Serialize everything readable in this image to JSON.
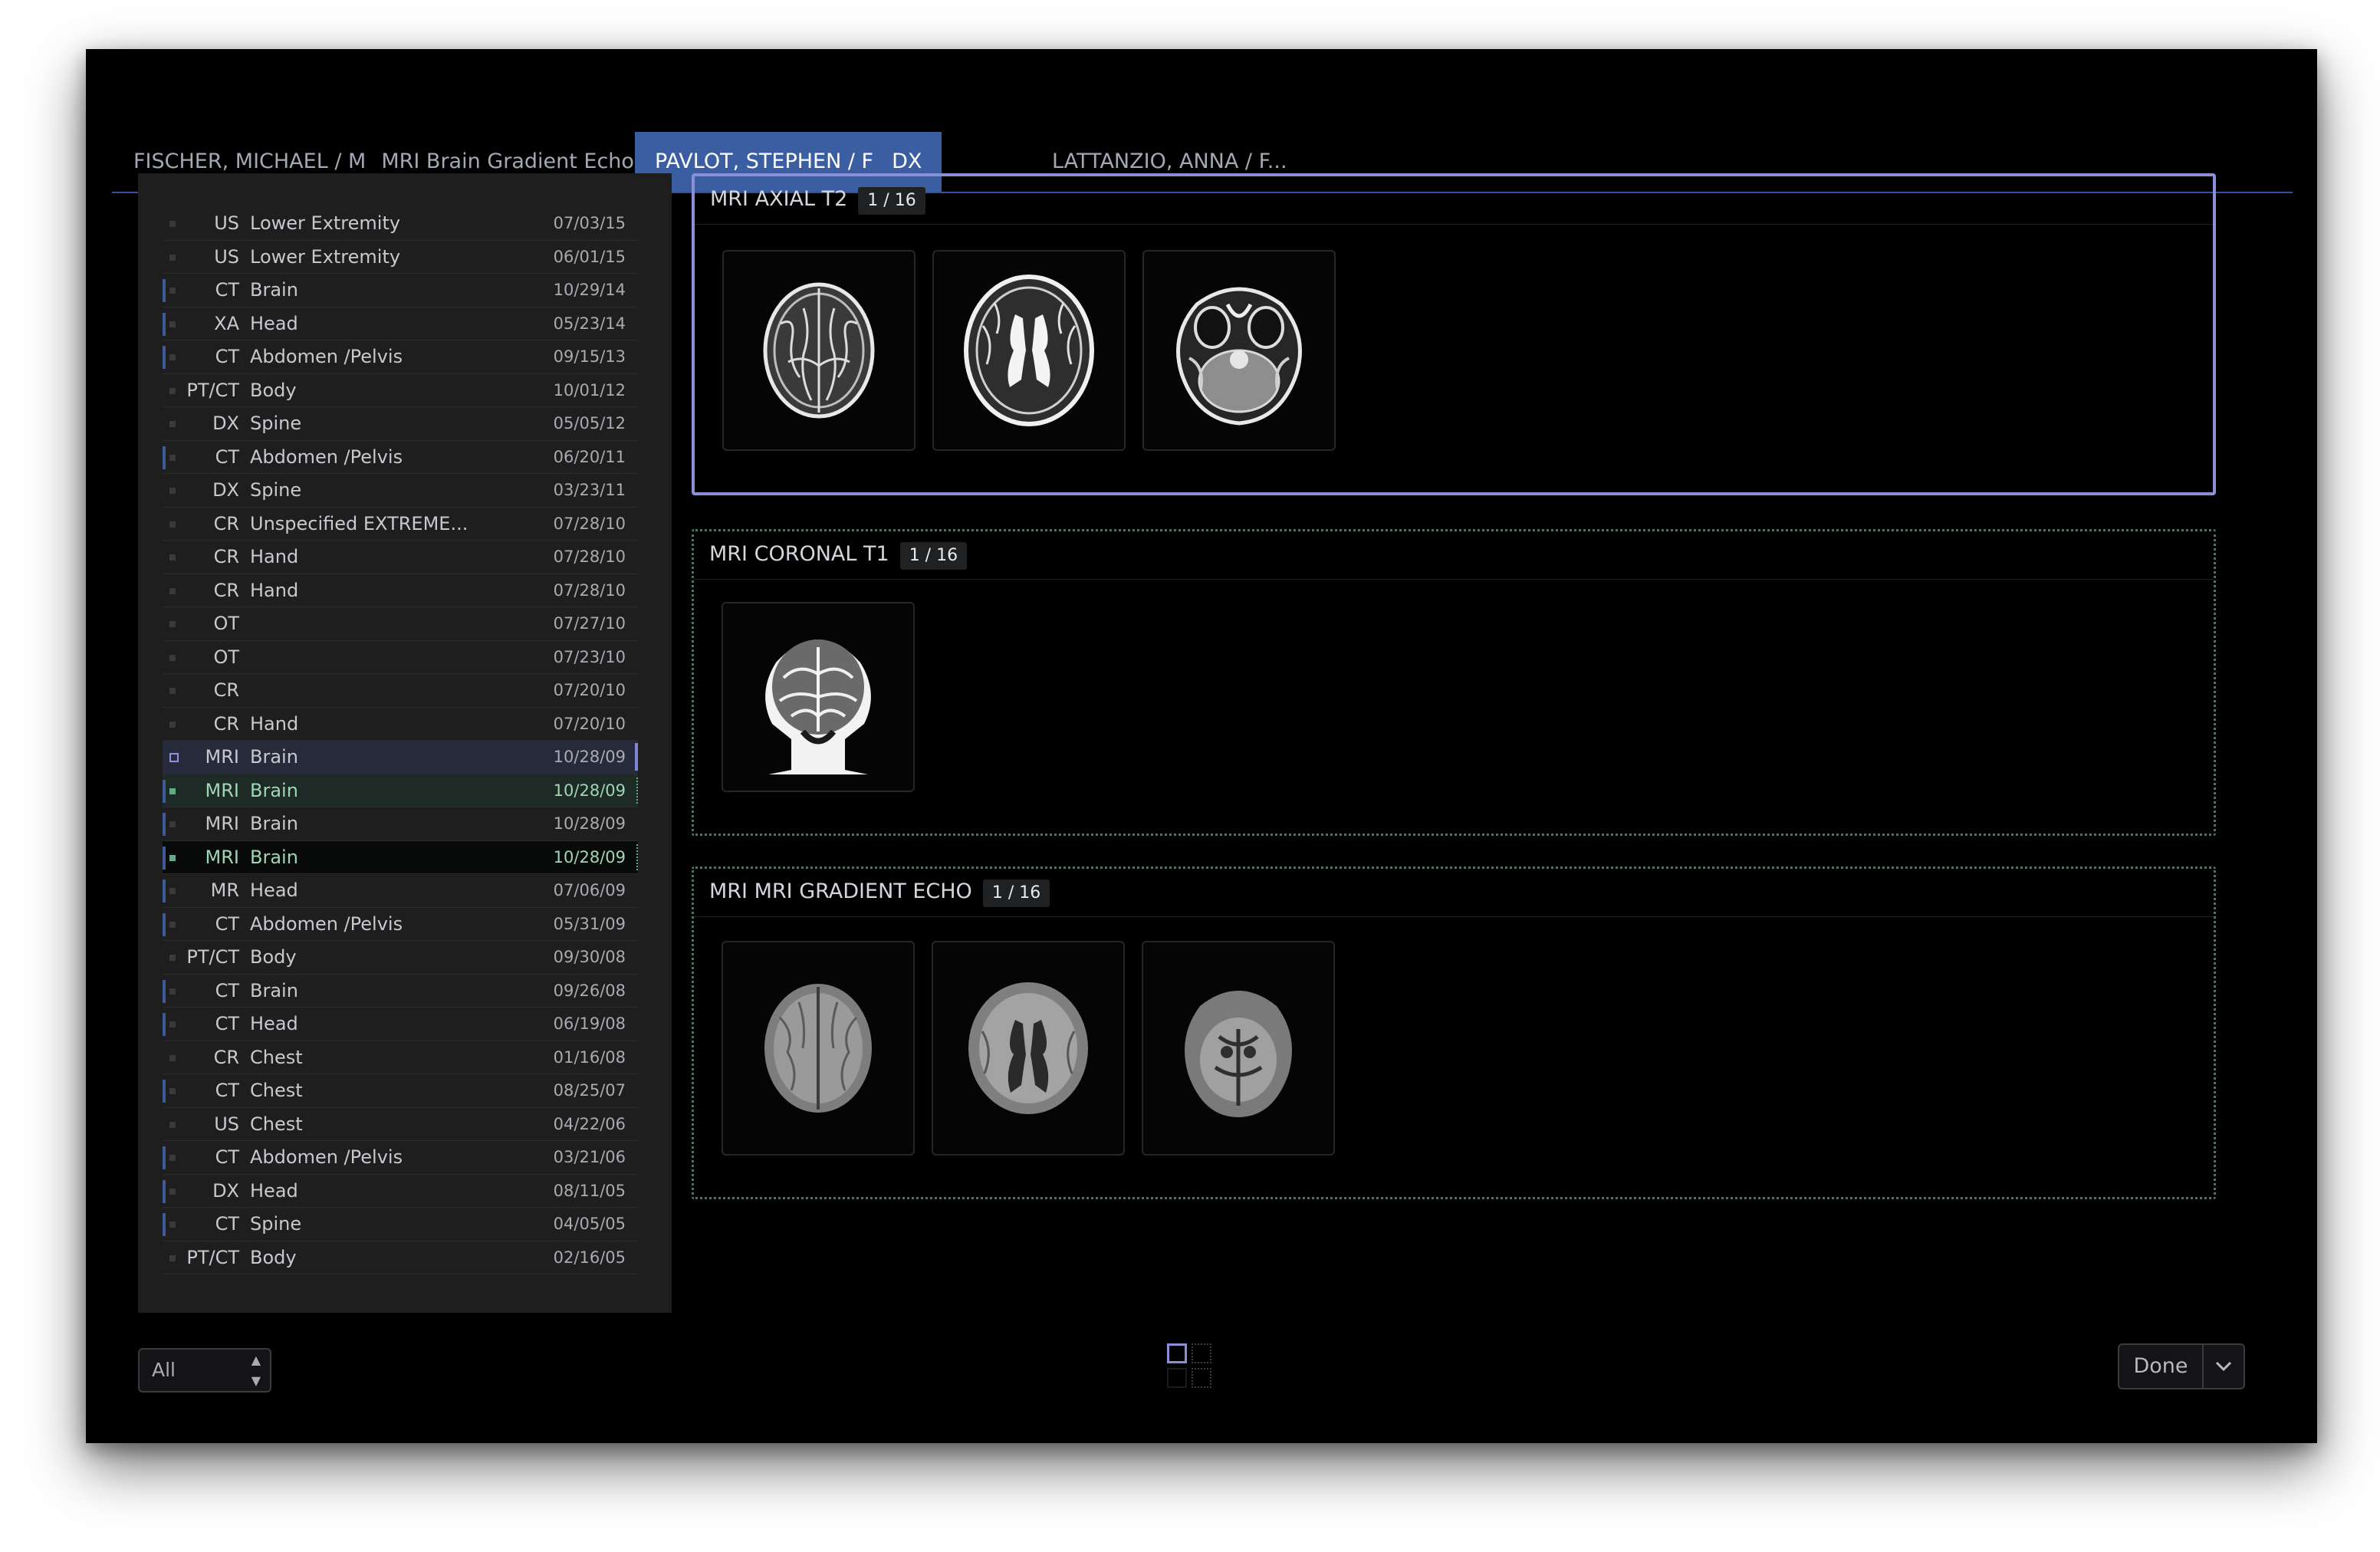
{
  "tabs": [
    {
      "name": "FISCHER, MICHAEL / M",
      "desc": "MRI Brain Gradient Echo"
    },
    {
      "name": "PAVLOT, STEPHEN / F",
      "desc": "DX"
    },
    {
      "name": "LATTANZIO, ANNA / F...",
      "desc": ""
    }
  ],
  "studies": [
    {
      "modality": "US",
      "desc": "Lower Extremity",
      "date": "07/03/15"
    },
    {
      "modality": "US",
      "desc": "Lower Extremity",
      "date": "06/01/15"
    },
    {
      "modality": "CT",
      "desc": "Brain",
      "date": "10/29/14"
    },
    {
      "modality": "XA",
      "desc": "Head",
      "date": "05/23/14"
    },
    {
      "modality": "CT",
      "desc": "Abdomen /Pelvis",
      "date": "09/15/13"
    },
    {
      "modality": "PT/CT",
      "desc": "Body",
      "date": "10/01/12"
    },
    {
      "modality": "DX",
      "desc": "Spine",
      "date": "05/05/12"
    },
    {
      "modality": "CT",
      "desc": "Abdomen /Pelvis",
      "date": "06/20/11"
    },
    {
      "modality": "DX",
      "desc": "Spine",
      "date": "03/23/11"
    },
    {
      "modality": "CR",
      "desc": "Unspecified EXTREME...",
      "date": "07/28/10"
    },
    {
      "modality": "CR",
      "desc": "Hand",
      "date": "07/28/10"
    },
    {
      "modality": "CR",
      "desc": "Hand",
      "date": "07/28/10"
    },
    {
      "modality": "OT",
      "desc": "",
      "date": "07/27/10"
    },
    {
      "modality": "OT",
      "desc": "",
      "date": "07/23/10"
    },
    {
      "modality": "CR",
      "desc": "",
      "date": "07/20/10"
    },
    {
      "modality": "CR",
      "desc": "Hand",
      "date": "07/20/10"
    },
    {
      "modality": "MRI",
      "desc": "Brain",
      "date": "10/28/09"
    },
    {
      "modality": "MRI",
      "desc": "Brain",
      "date": "10/28/09"
    },
    {
      "modality": "MRI",
      "desc": "Brain",
      "date": "10/28/09"
    },
    {
      "modality": "MRI",
      "desc": "Brain",
      "date": "10/28/09"
    },
    {
      "modality": "MR",
      "desc": "Head",
      "date": "07/06/09"
    },
    {
      "modality": "CT",
      "desc": "Abdomen /Pelvis",
      "date": "05/31/09"
    },
    {
      "modality": "PT/CT",
      "desc": "Body",
      "date": "09/30/08"
    },
    {
      "modality": "CT",
      "desc": "Brain",
      "date": "09/26/08"
    },
    {
      "modality": "CT",
      "desc": "Head",
      "date": "06/19/08"
    },
    {
      "modality": "CR",
      "desc": "Chest",
      "date": "01/16/08"
    },
    {
      "modality": "CT",
      "desc": "Chest",
      "date": "08/25/07"
    },
    {
      "modality": "US",
      "desc": "Chest",
      "date": "04/22/06"
    },
    {
      "modality": "CT",
      "desc": "Abdomen /Pelvis",
      "date": "03/21/06"
    },
    {
      "modality": "DX",
      "desc": "Head",
      "date": "08/11/05"
    },
    {
      "modality": "CT",
      "desc": "Spine",
      "date": "04/05/05"
    },
    {
      "modality": "PT/CT",
      "desc": "Body",
      "date": "02/16/05"
    }
  ],
  "series": [
    {
      "title": "MRI AXIAL T2",
      "count": "1 / 16"
    },
    {
      "title": "MRI CORONAL T1",
      "count": "1 / 16"
    },
    {
      "title": "MRI MRI GRADIENT ECHO",
      "count": "1 / 16"
    }
  ],
  "filter": {
    "value": "All"
  },
  "footer": {
    "done_label": "Done"
  },
  "colors": {
    "accent_blue": "#3b5ea3",
    "selection_lavender": "#8b8fd8",
    "selection_green": "#5fae85"
  },
  "icons": {
    "filter_arrows": "up-down-arrows",
    "done_menu": "chevron-down",
    "layout": "grid-2x2"
  }
}
